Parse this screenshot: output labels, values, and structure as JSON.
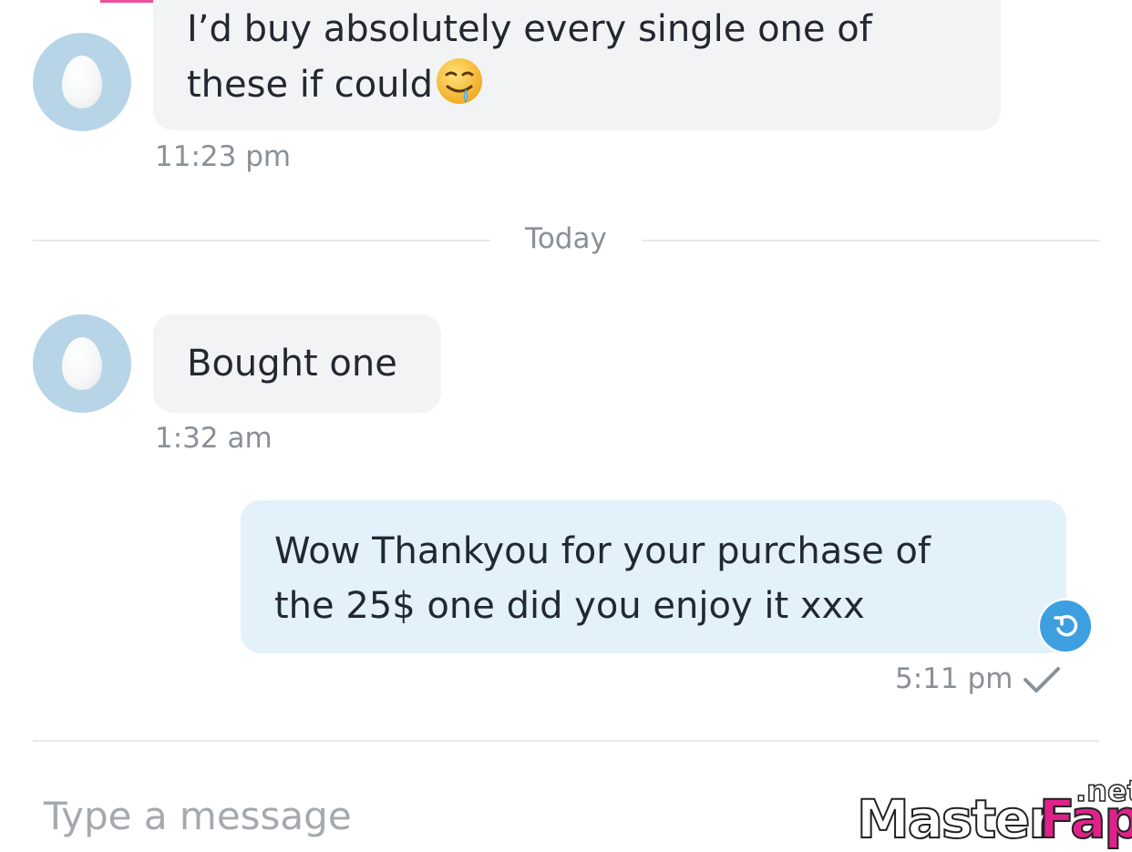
{
  "messages": [
    {
      "direction": "incoming",
      "text_line1": "I’d buy absolutely every single one of",
      "text_line2": "these if could",
      "emoji": "drooling-face-icon",
      "time": "11:23 pm"
    },
    {
      "direction": "incoming",
      "text": "Bought one",
      "time": "1:32 am"
    },
    {
      "direction": "outgoing",
      "text_line1": "Wow Thankyou for your purchase of",
      "text_line2": "the 25$ one did you enjoy it xxx",
      "time": "5:11 pm",
      "status": "sent-check-icon"
    }
  ],
  "day_separator": "Today",
  "composer": {
    "placeholder": "Type a message"
  },
  "watermark": {
    "main": "Master",
    "accent": "Fap",
    "suffix": ".net"
  },
  "colors": {
    "incoming_bubble": "#f2f3f4",
    "outgoing_bubble": "#e3f1fb",
    "accent_blue": "#3d9fe0",
    "avatar_bg": "#b7d5e6",
    "timestamp": "#8a9097",
    "top_accent": "#f04e98"
  }
}
